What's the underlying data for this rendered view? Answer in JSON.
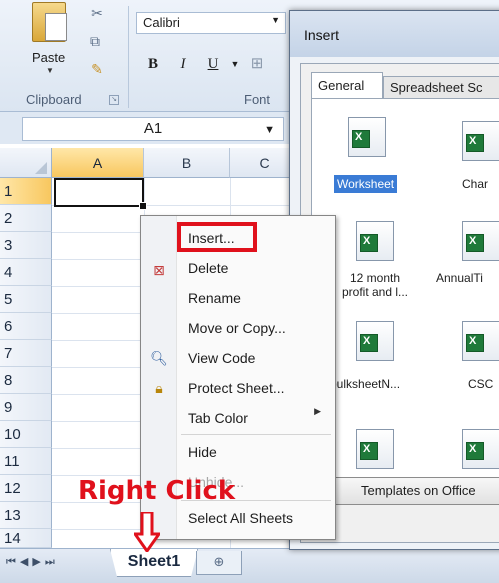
{
  "ribbon": {
    "paste_label": "Paste",
    "font_name": "Calibri",
    "bold": "B",
    "italic": "I",
    "underline": "U",
    "group_clipboard": "Clipboard",
    "group_font": "Font"
  },
  "formula_bar": {
    "name_box": "A1"
  },
  "grid": {
    "columns": [
      "A",
      "B",
      "C"
    ],
    "rows": [
      "1",
      "2",
      "3",
      "4",
      "5",
      "6",
      "7",
      "8",
      "9",
      "10",
      "11",
      "12",
      "13",
      "14"
    ]
  },
  "sheet_tabs": {
    "active": "Sheet1"
  },
  "dialog": {
    "title": "Insert",
    "tabs": [
      "General",
      "Spreadsheet Sc"
    ],
    "items": [
      {
        "label": "Worksheet",
        "icon": "worksheet-icon"
      },
      {
        "label": "Char",
        "icon": "chart-icon"
      },
      {
        "label": "12 month\nprofit and l...",
        "icon": "spreadsheet-template-icon"
      },
      {
        "label": "AnnualTi",
        "icon": "spreadsheet-template-icon"
      },
      {
        "label": "bulksheetN...",
        "icon": "spreadsheet-template-icon"
      },
      {
        "label": "CSC",
        "icon": "spreadsheet-template-icon"
      }
    ],
    "templates_button": "Templates on Office"
  },
  "context_menu": {
    "items": [
      {
        "label": "Insert...",
        "icon": ""
      },
      {
        "label": "Delete",
        "icon": "delete-sheet-icon"
      },
      {
        "label": "Rename",
        "icon": ""
      },
      {
        "label": "Move or Copy...",
        "icon": ""
      },
      {
        "label": "View Code",
        "icon": "view-code-icon"
      },
      {
        "label": "Protect Sheet...",
        "icon": "protect-sheet-icon"
      },
      {
        "label": "Tab Color",
        "icon": ""
      },
      {
        "label": "Hide",
        "icon": ""
      },
      {
        "label": "Unhide...",
        "icon": ""
      },
      {
        "label": "Select All Sheets",
        "icon": ""
      }
    ]
  },
  "annotation": {
    "text": "Right Click",
    "color": "#e0111c"
  },
  "colors": {
    "ribbon": "#dbe5f1",
    "selection_header": "#f8c75f",
    "highlight": "#e0111c",
    "dialog_selection": "#3a7bd5"
  }
}
